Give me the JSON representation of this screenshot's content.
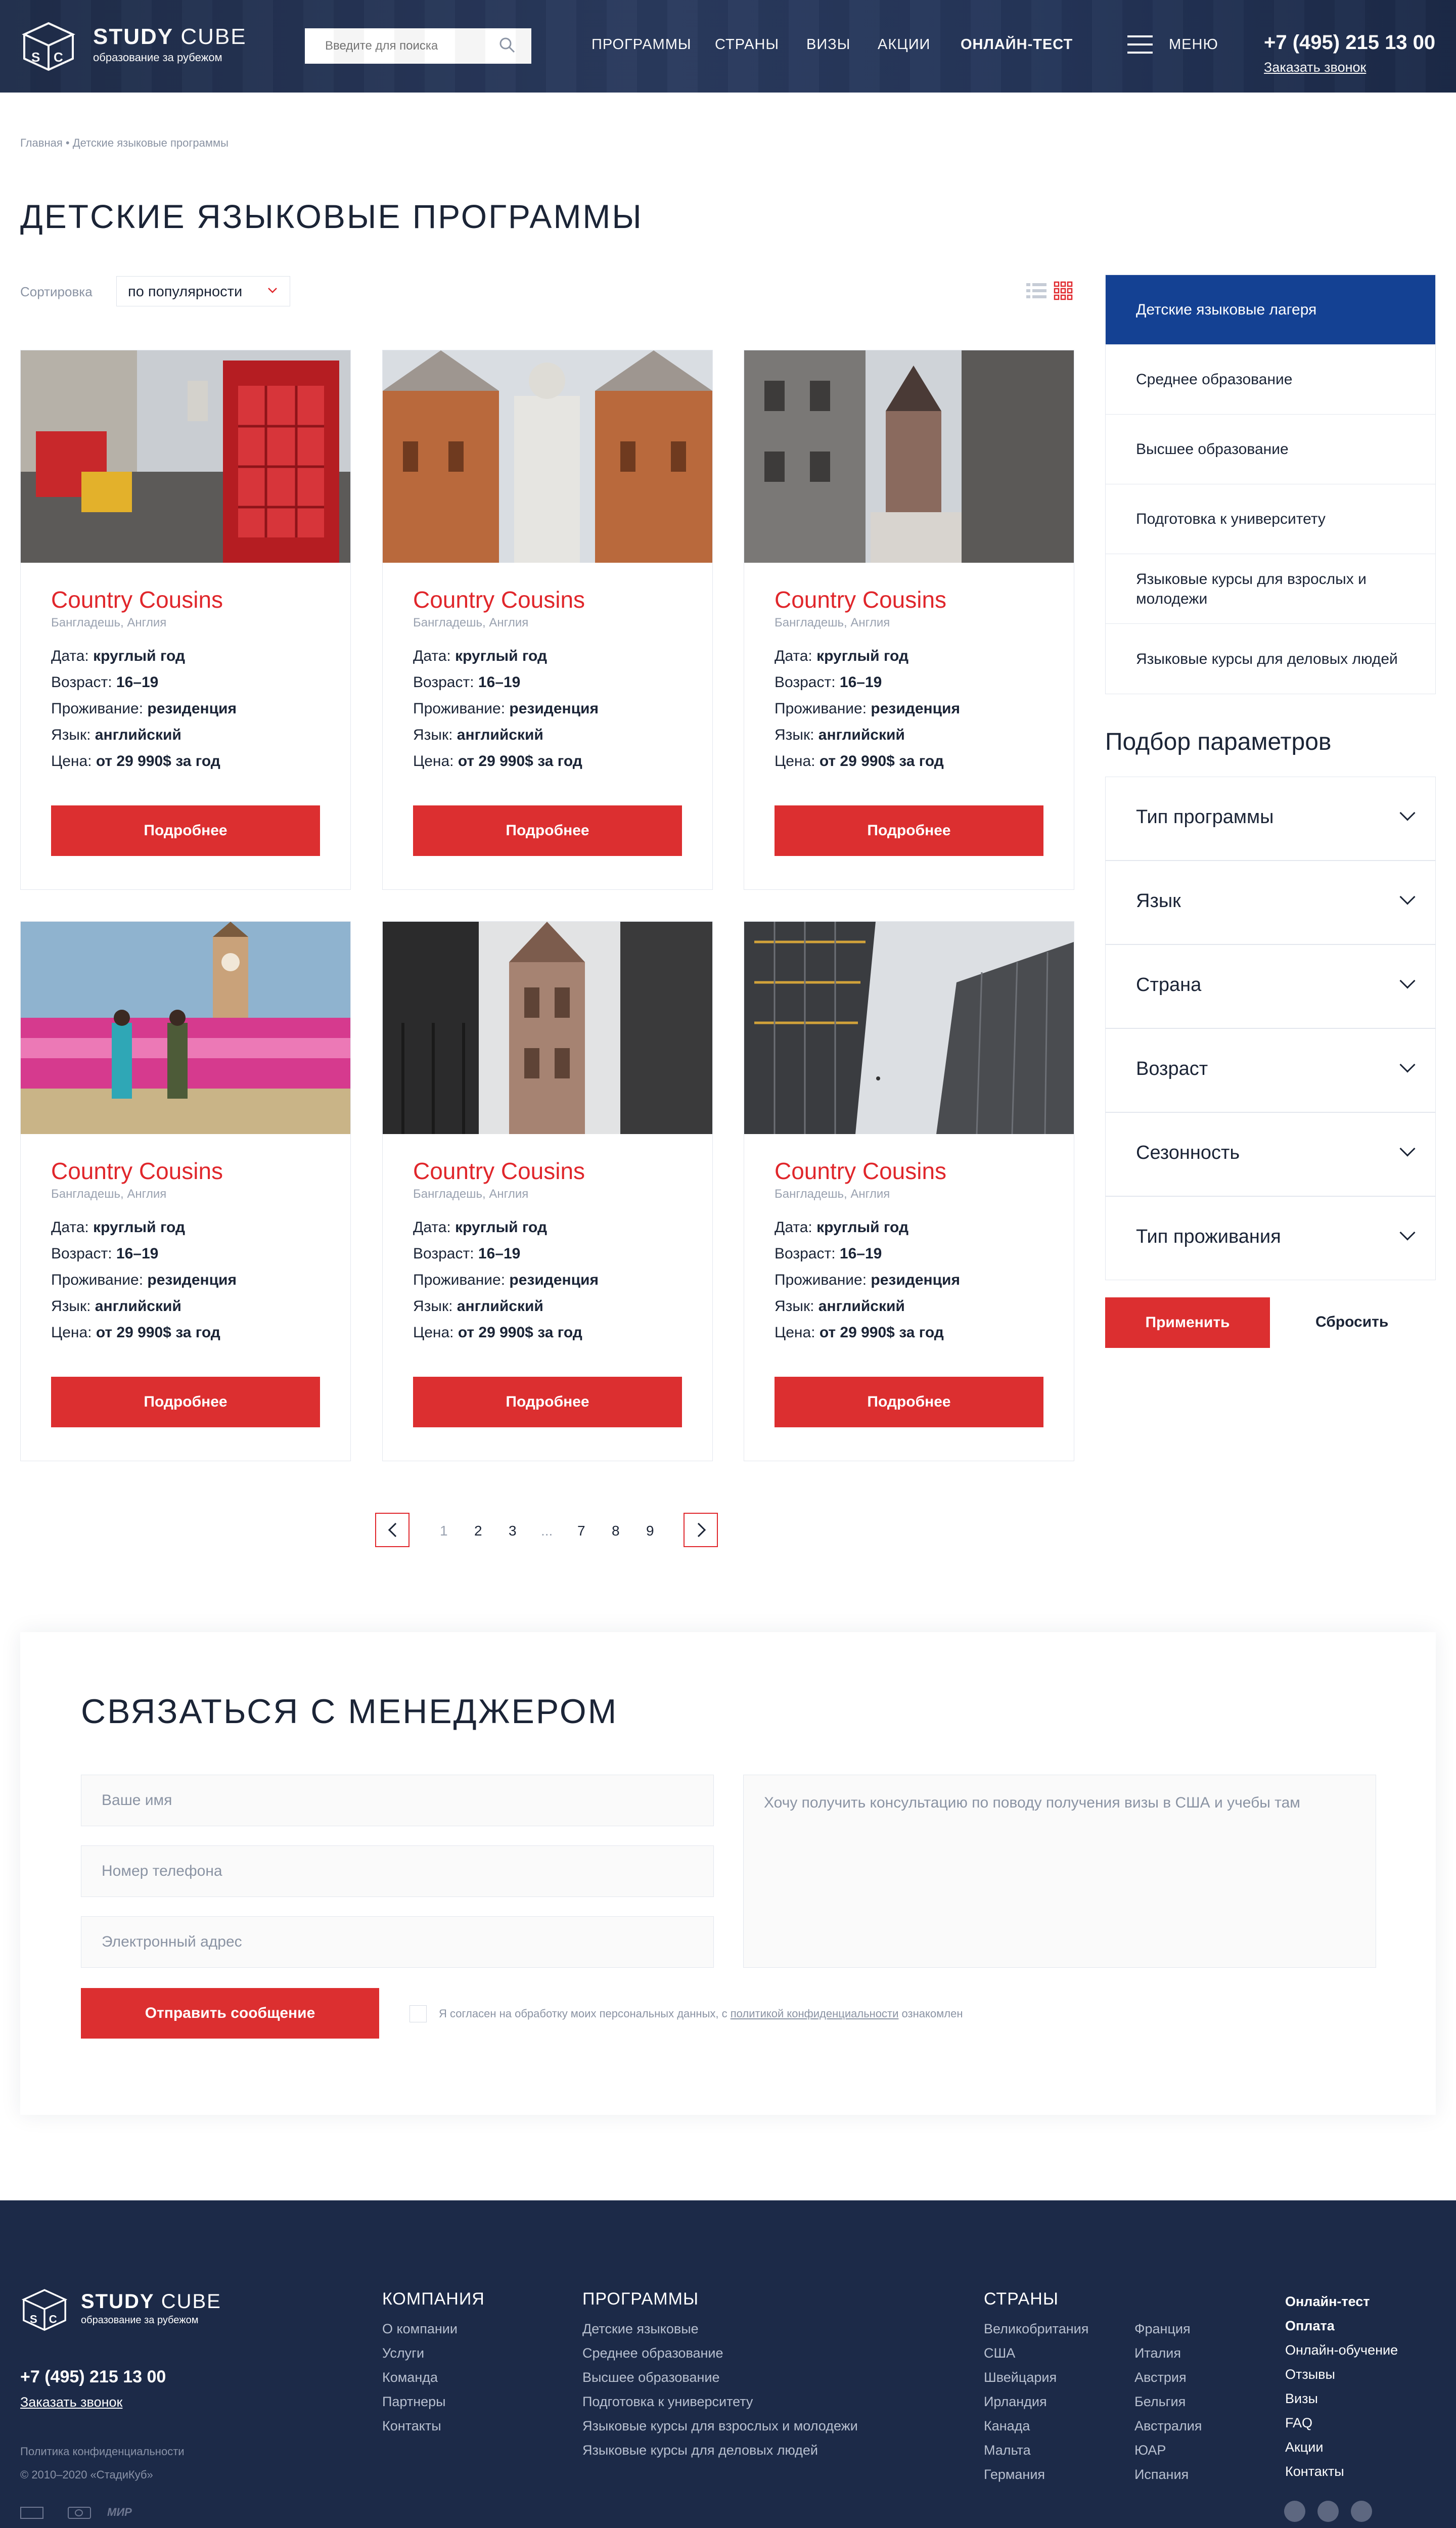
{
  "header": {
    "logo_title_bold": "STUDY",
    "logo_title_light": " CUBE",
    "logo_subtitle": "образование за рубежом",
    "search_placeholder": "Введите для поиска",
    "nav": [
      "ПРОГРАММЫ",
      "СТРАНЫ",
      "ВИЗЫ",
      "АКЦИИ",
      "ОНЛАЙН-ТЕСТ"
    ],
    "menu_label": "МЕНЮ",
    "phone": "+7 (495) 215 13 00",
    "callback": "Заказать звонок"
  },
  "breadcrumb": {
    "home": "Главная",
    "sep": "•",
    "current": "Детские языковые программы"
  },
  "page_title": "ДЕТСКИЕ ЯЗЫКОВЫЕ ПРОГРАММЫ",
  "sort": {
    "label": "Сортировка",
    "value": "по популярности"
  },
  "cards": [
    {
      "title": "Country Cousins",
      "location": "Бангладешь, Англия",
      "date_label": "Дата:",
      "date": "круглый год",
      "age_label": "Возраст:",
      "age": "16–19",
      "housing_label": "Проживание:",
      "housing": "резиденция",
      "lang_label": "Язык:",
      "lang": "английский",
      "price_label": "Цена:",
      "price": "от 29 990$ за год",
      "button": "Подробнее"
    },
    {
      "title": "Country Cousins",
      "location": "Бангладешь, Англия",
      "date_label": "Дата:",
      "date": "круглый год",
      "age_label": "Возраст:",
      "age": "16–19",
      "housing_label": "Проживание:",
      "housing": "резиденция",
      "lang_label": "Язык:",
      "lang": "английский",
      "price_label": "Цена:",
      "price": "от 29 990$ за год",
      "button": "Подробнее"
    },
    {
      "title": "Country Cousins",
      "location": "Бангладешь, Англия",
      "date_label": "Дата:",
      "date": "круглый год",
      "age_label": "Возраст:",
      "age": "16–19",
      "housing_label": "Проживание:",
      "housing": "резиденция",
      "lang_label": "Язык:",
      "lang": "английский",
      "price_label": "Цена:",
      "price": "от 29 990$ за год",
      "button": "Подробнее"
    },
    {
      "title": "Country Cousins",
      "location": "Бангладешь, Англия",
      "date_label": "Дата:",
      "date": "круглый год",
      "age_label": "Возраст:",
      "age": "16–19",
      "housing_label": "Проживание:",
      "housing": "резиденция",
      "lang_label": "Язык:",
      "lang": "английский",
      "price_label": "Цена:",
      "price": "от 29 990$ за год",
      "button": "Подробнее"
    },
    {
      "title": "Country Cousins",
      "location": "Бангладешь, Англия",
      "date_label": "Дата:",
      "date": "круглый год",
      "age_label": "Возраст:",
      "age": "16–19",
      "housing_label": "Проживание:",
      "housing": "резиденция",
      "lang_label": "Язык:",
      "lang": "английский",
      "price_label": "Цена:",
      "price": "от 29 990$ за год",
      "button": "Подробнее"
    },
    {
      "title": "Country Cousins",
      "location": "Бангладешь, Англия",
      "date_label": "Дата:",
      "date": "круглый год",
      "age_label": "Возраст:",
      "age": "16–19",
      "housing_label": "Проживание:",
      "housing": "резиденция",
      "lang_label": "Язык:",
      "lang": "английский",
      "price_label": "Цена:",
      "price": "от 29 990$ за год",
      "button": "Подробнее"
    }
  ],
  "sidebar": {
    "categories": [
      "Детские языковые лагеря",
      "Среднее образование",
      "Высшее образование",
      "Подготовка к университету",
      "Языковые курсы для взрослых и молодежи",
      "Языковые курсы для деловых людей"
    ],
    "params_title": "Подбор параметров",
    "filters": [
      "Тип программы",
      "Язык",
      "Страна",
      "Возраст",
      "Сезонность",
      "Тип проживания"
    ],
    "apply": "Применить",
    "reset": "Сбросить"
  },
  "pagination": {
    "pages": [
      "1",
      "2",
      "3",
      "...",
      "7",
      "8",
      "9"
    ],
    "current": "1"
  },
  "contact": {
    "title": "СВЯЗАТЬСЯ С МЕНЕДЖЕРОМ",
    "name_placeholder": "Ваше имя",
    "phone_placeholder": "Номер телефона",
    "email_placeholder": "Электронный адрес",
    "message_placeholder": "Хочу получить консультацию по поводу получения визы в США и учебы там",
    "submit": "Отправить сообщение",
    "consent_prefix": "Я согласен на обработку моих персональных данных, с ",
    "consent_link": "политикой конфиденциальности",
    "consent_suffix": " ознакомлен"
  },
  "footer": {
    "phone": "+7 (495) 215 13 00",
    "callback": "Заказать звонок",
    "privacy": "Политика конфиденциальности",
    "copyright": "© 2010–2020 «СтадиКуб»",
    "pay_mir": "МИР",
    "company_title": "КОМПАНИЯ",
    "company": [
      "О компании",
      "Услуги",
      "Команда",
      "Партнеры",
      "Контакты"
    ],
    "programs_title": "ПРОГРАММЫ",
    "programs": [
      "Детские языковые",
      "Среднее образование",
      "Высшее образование",
      "Подготовка к университету",
      "Языковые курсы для взрослых и молодежи",
      "Языковые курсы для деловых людей"
    ],
    "countries_title": "СТРАНЫ",
    "countries_col1": [
      "Великобритания",
      "США",
      "Швейцария",
      "Ирландия",
      "Канада",
      "Мальта",
      "Германия"
    ],
    "countries_col2": [
      "Франция",
      "Италия",
      "Австрия",
      "Бельгия",
      "Австралия",
      "ЮАР",
      "Испания"
    ],
    "extra_bold": [
      "Онлайн-тест",
      "Оплата"
    ],
    "extra": [
      "Онлайн-обучение",
      "Отзывы",
      "Визы",
      "FAQ",
      "Акции",
      "Контакты"
    ]
  },
  "colors": {
    "accent_red": "#dc2f30",
    "active_blue": "#144193",
    "header_bg": "#1f2d4a",
    "footer_bg": "#1c2a48"
  }
}
